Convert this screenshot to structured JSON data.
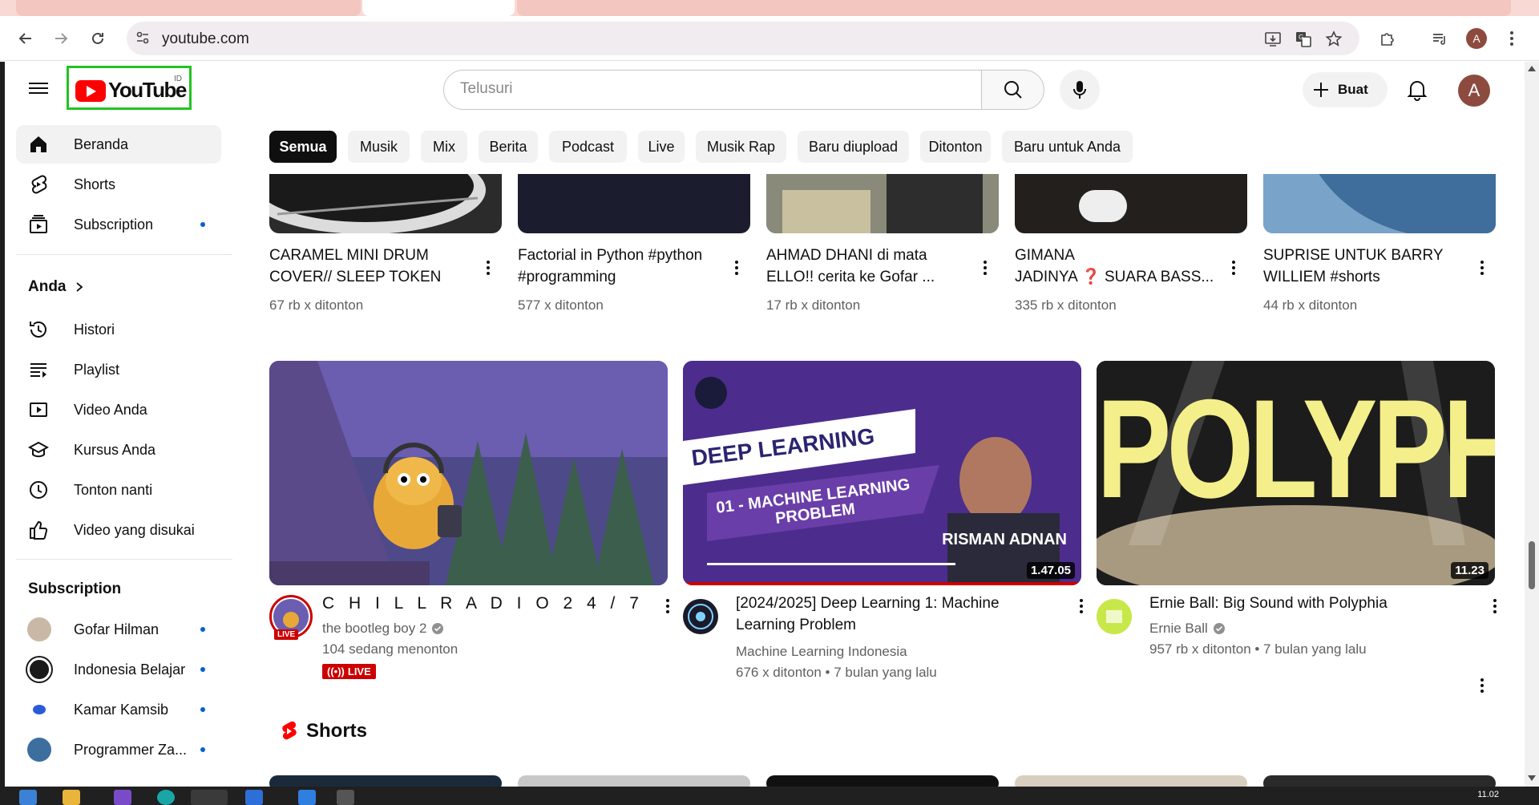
{
  "browser": {
    "url": "youtube.com",
    "profile_initial": "A",
    "clock": "11.02"
  },
  "masthead": {
    "logo_text": "YouTube",
    "logo_region": "ID",
    "search_placeholder": "Telusuri",
    "create_label": "Buat",
    "avatar_initial": "A"
  },
  "sidebar": {
    "main": [
      {
        "label": "Beranda",
        "icon": "home-icon",
        "active": true
      },
      {
        "label": "Shorts",
        "icon": "shorts-icon"
      },
      {
        "label": "Subscription",
        "icon": "subscriptions-icon",
        "dot": true
      }
    ],
    "you_heading": "Anda",
    "you_items": [
      {
        "label": "Histori",
        "icon": "history-icon"
      },
      {
        "label": "Playlist",
        "icon": "playlist-icon"
      },
      {
        "label": "Video Anda",
        "icon": "your-videos-icon"
      },
      {
        "label": "Kursus Anda",
        "icon": "courses-icon"
      },
      {
        "label": "Tonton nanti",
        "icon": "watch-later-icon"
      },
      {
        "label": "Video yang disukai",
        "icon": "liked-icon"
      }
    ],
    "subs_heading": "Subscription",
    "subs": [
      {
        "label": "Gofar Hilman",
        "color": "#c9b8a6"
      },
      {
        "label": "Indonesia Belajar",
        "color": "#1a1a1a"
      },
      {
        "label": "Kamar Kamsib",
        "color": "#2a5bd7"
      },
      {
        "label": "Programmer Za...",
        "color": "#3c6e9e"
      }
    ]
  },
  "chips": [
    "Semua",
    "Musik",
    "Mix",
    "Berita",
    "Podcast",
    "Live",
    "Musik Rap",
    "Baru diupload",
    "Ditonton",
    "Baru untuk Anda"
  ],
  "row1": [
    {
      "title1": "CARAMEL MINI DRUM",
      "title2": "COVER// SLEEP TOKEN",
      "meta": "67 rb x ditonton",
      "thumb": "#2b2b2b"
    },
    {
      "title1": "Factorial in Python #python",
      "title2": "#programming",
      "meta": "577 x ditonton",
      "thumb": "#1b1d2e"
    },
    {
      "title1": "AHMAD DHANI di mata",
      "title2": "ELLO!! cerita ke Gofar ...",
      "meta": "17 rb x ditonton",
      "thumb": "#6b6b5a"
    },
    {
      "title1": "GIMANA",
      "title2": "JADINYA ❓ SUARA BASS...",
      "meta": "335 rb x ditonton",
      "thumb": "#221f1d"
    },
    {
      "title1": "SUPRISE UNTUK BARRY",
      "title2": "WILLIEM #shorts",
      "meta": "44 rb x ditonton",
      "thumb": "#4f7fb0"
    }
  ],
  "row2": [
    {
      "title": "C H I L L   R A D I O 2 4 / 7",
      "title2": "",
      "channel": "the bootleg boy 2",
      "meta": "104 sedang menonton",
      "live_label": "LIVE",
      "live_ring": "LIVE",
      "duration": ""
    },
    {
      "title": "[2024/2025] Deep Learning 1: Machine",
      "title2": "Learning Problem",
      "channel": "Machine Learning Indonesia",
      "meta": "676 x ditonton • 7 bulan yang lalu",
      "duration": "1.47.05",
      "thumb_line1": "DEEP LEARNING",
      "thumb_line2": "01 - MACHINE LEARNING",
      "thumb_line3": "PROBLEM",
      "thumb_name": "RISMAN ADNAN"
    },
    {
      "title": "Ernie Ball: Big Sound with Polyphia",
      "title2": "",
      "channel": "Ernie Ball",
      "meta": "957 rb x ditonton • 7 bulan yang lalu",
      "duration": "11.23",
      "thumb_text": "POLYPHIA"
    }
  ],
  "shorts_heading": "Shorts"
}
